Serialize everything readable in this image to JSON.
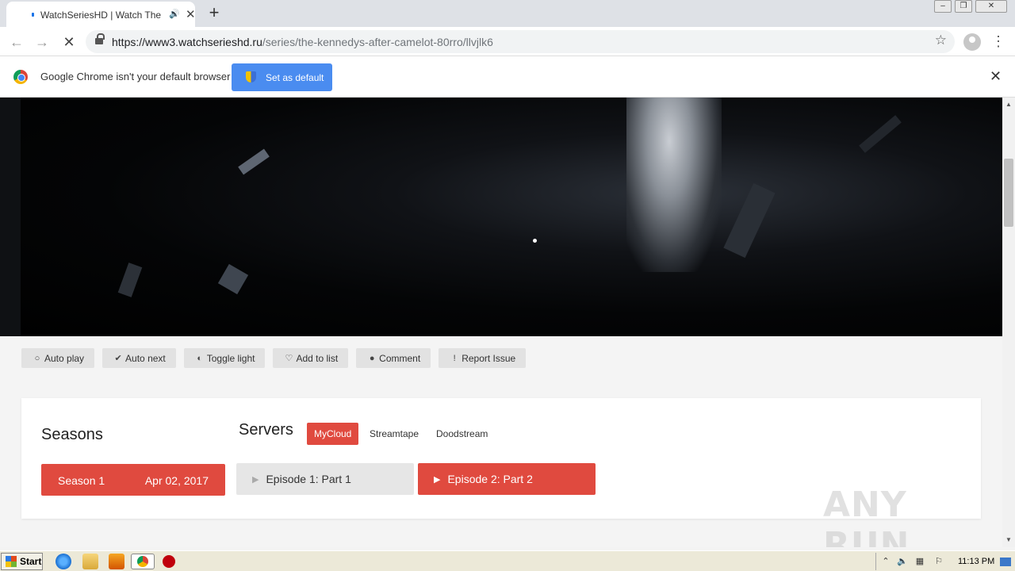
{
  "browser": {
    "tab_title": "WatchSeriesHD | Watch The Ke",
    "url_host": "https://www3.watchserieshd.ru",
    "url_path": "/series/the-kennedys-after-camelot-80rro/llvjlk6",
    "new_tab_symbol": "+",
    "close_symbol": "✕"
  },
  "infobar": {
    "message": "Google Chrome isn't your default browser",
    "button_label": "Set as default",
    "close_symbol": "✕"
  },
  "actions": [
    {
      "icon": "circle-icon",
      "glyph": "○",
      "label": "Auto play"
    },
    {
      "icon": "check-circle-icon",
      "glyph": "✔",
      "label": "Auto next"
    },
    {
      "icon": "contrast-icon",
      "glyph": "◐",
      "label": "Toggle light"
    },
    {
      "icon": "heart-icon",
      "glyph": "♡",
      "label": "Add to list"
    },
    {
      "icon": "comment-icon",
      "glyph": "●",
      "label": "Comment"
    },
    {
      "icon": "alert-icon",
      "glyph": "!",
      "label": "Report Issue"
    }
  ],
  "seasons": {
    "title": "Seasons",
    "items": [
      {
        "label": "Season 1",
        "date": "Apr 02, 2017"
      }
    ]
  },
  "servers": {
    "title": "Servers",
    "items": [
      {
        "label": "MyCloud",
        "active": true
      },
      {
        "label": "Streamtape",
        "active": false
      },
      {
        "label": "Doodstream",
        "active": false
      }
    ]
  },
  "episodes": [
    {
      "label": "Episode 1: Part 1",
      "active": false
    },
    {
      "label": "Episode 2: Part 2",
      "active": true
    }
  ],
  "watermark": "ANY RUN",
  "taskbar": {
    "start_label": "Start",
    "clock": "11:13 PM"
  },
  "colors": {
    "accent_red": "#e04a3f",
    "chrome_blue": "#4a8cf0"
  }
}
